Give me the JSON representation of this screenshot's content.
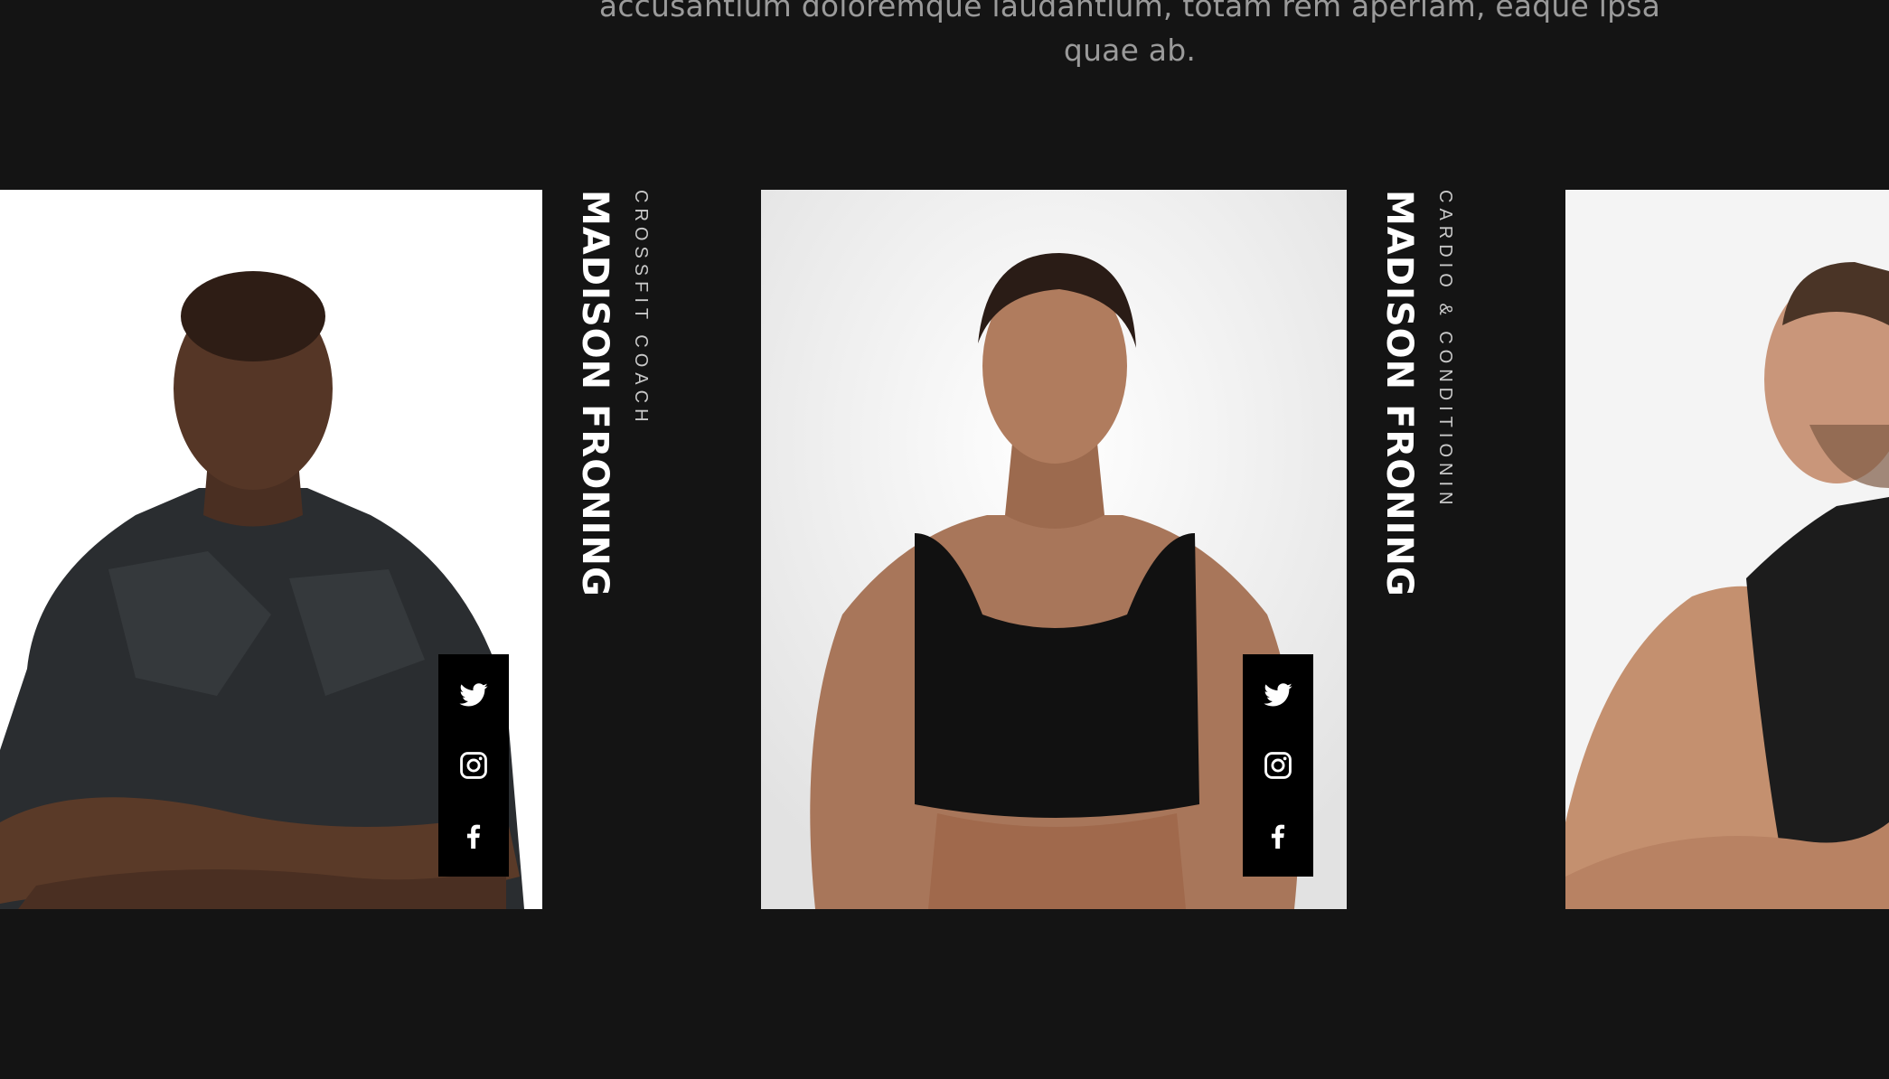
{
  "intro": {
    "line1": "accusantium doloremque laudantium, totam rem aperiam, eaque ipsa",
    "line2": "quae ab."
  },
  "trainers": [
    {
      "name": "MADISON FRONING",
      "role": "CROSSFIT COACH",
      "social": [
        "twitter-icon",
        "instagram-icon",
        "facebook-icon"
      ]
    },
    {
      "name": "MADISON FRONING",
      "role": "CARDIO & CONDITIONIN",
      "social": [
        "twitter-icon",
        "instagram-icon",
        "facebook-icon"
      ]
    },
    {
      "name": "",
      "role": ""
    }
  ],
  "colors": {
    "background": "#141414",
    "intro_text": "#9a9a9a",
    "name_text": "#ffffff",
    "role_text": "#c9c9c9",
    "social_bar": "#000000"
  }
}
